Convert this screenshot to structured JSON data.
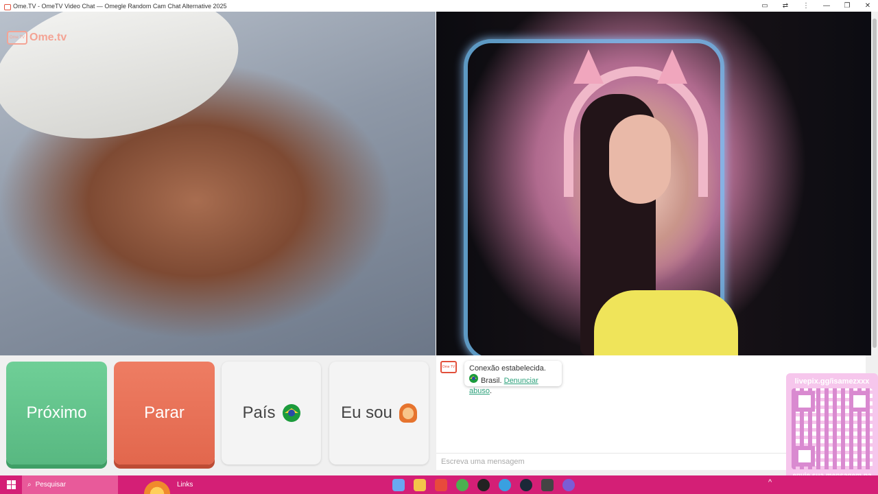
{
  "window": {
    "title": "Ome.TV - OmeTV Video Chat — Omegle Random Cam Chat Alternative 2025",
    "controls": {
      "camera": "▭",
      "translate": "⇄",
      "more": "⋮",
      "minimize": "—",
      "restore": "❐",
      "close": "✕"
    }
  },
  "logo": {
    "badge": "Ome TV",
    "text": "Ome.tv"
  },
  "buttons": {
    "next": "Próximo",
    "stop": "Parar",
    "country": "País",
    "gender": "Eu sou"
  },
  "chat": {
    "avatar": "Ome TV",
    "status": "Conexão estabelecida.",
    "country": "Brasil.",
    "report": "Denunciar abuso",
    "report_suffix": ".",
    "input_placeholder": "Escreva uma mensagem"
  },
  "overlay": {
    "url": "livepix.gg/isamezxxx",
    "message": "envie sua mensagem na live via pix!"
  },
  "taskbar": {
    "search": "Pesquisar",
    "links": "Links",
    "tray_arrow": "^"
  },
  "colors": {
    "accent_green": "#6fcf97",
    "accent_red": "#ee7d63",
    "taskbar": "#d41f76"
  }
}
